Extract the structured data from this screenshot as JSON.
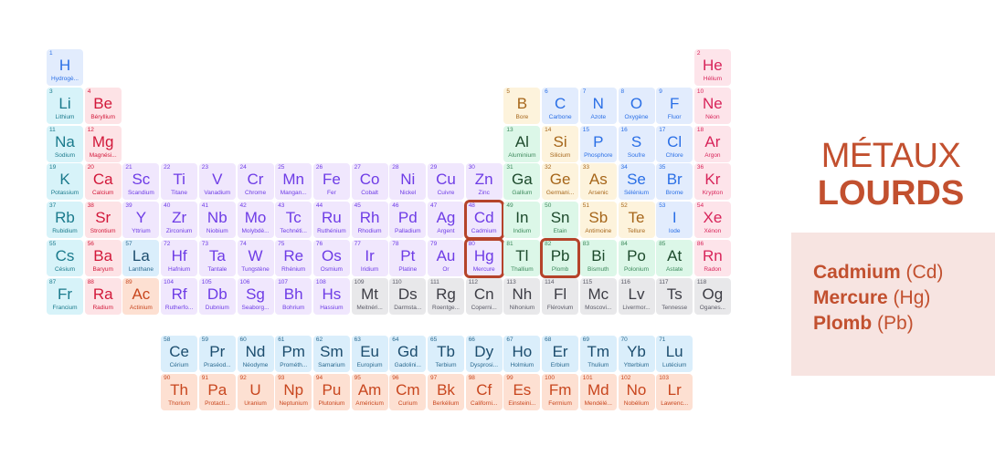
{
  "title": {
    "line1": "MÉTAUX",
    "line2": "LOURDS"
  },
  "heavy_metals": [
    {
      "name": "Cadmium",
      "symbol": "(Cd)"
    },
    {
      "name": "Mercure",
      "symbol": "(Hg)"
    },
    {
      "name": "Plomb",
      "symbol": "(Pb)"
    }
  ],
  "highlighted_symbols": [
    "Cd",
    "Hg",
    "Pb"
  ],
  "colors": {
    "accent": "#c2502f",
    "highlight_border": "#b5432a",
    "panel_bg": "#f7e4e1"
  },
  "elements": [
    {
      "n": 1,
      "s": "H",
      "name": "Hydrogè...",
      "c": "nonmetal",
      "row": 1,
      "col": 1
    },
    {
      "n": 2,
      "s": "He",
      "name": "Hélium",
      "c": "noble",
      "row": 1,
      "col": 18
    },
    {
      "n": 3,
      "s": "Li",
      "name": "Lithium",
      "c": "alkali",
      "row": 2,
      "col": 1
    },
    {
      "n": 4,
      "s": "Be",
      "name": "Béryllium",
      "c": "alkaline",
      "row": 2,
      "col": 2
    },
    {
      "n": 5,
      "s": "B",
      "name": "Bore",
      "c": "metalloid",
      "row": 2,
      "col": 13
    },
    {
      "n": 6,
      "s": "C",
      "name": "Carbone",
      "c": "nonmetal",
      "row": 2,
      "col": 14
    },
    {
      "n": 7,
      "s": "N",
      "name": "Azote",
      "c": "nonmetal",
      "row": 2,
      "col": 15
    },
    {
      "n": 8,
      "s": "O",
      "name": "Oxygène",
      "c": "nonmetal",
      "row": 2,
      "col": 16
    },
    {
      "n": 9,
      "s": "F",
      "name": "Fluor",
      "c": "nonmetal",
      "row": 2,
      "col": 17
    },
    {
      "n": 10,
      "s": "Ne",
      "name": "Néon",
      "c": "noble",
      "row": 2,
      "col": 18
    },
    {
      "n": 11,
      "s": "Na",
      "name": "Sodium",
      "c": "alkali",
      "row": 3,
      "col": 1
    },
    {
      "n": 12,
      "s": "Mg",
      "name": "Magnési...",
      "c": "alkaline",
      "row": 3,
      "col": 2
    },
    {
      "n": 13,
      "s": "Al",
      "name": "Aluminium",
      "c": "postt",
      "row": 3,
      "col": 13
    },
    {
      "n": 14,
      "s": "Si",
      "name": "Silicium",
      "c": "metalloid",
      "row": 3,
      "col": 14
    },
    {
      "n": 15,
      "s": "P",
      "name": "Phosphore",
      "c": "nonmetal",
      "row": 3,
      "col": 15
    },
    {
      "n": 16,
      "s": "S",
      "name": "Soufre",
      "c": "nonmetal",
      "row": 3,
      "col": 16
    },
    {
      "n": 17,
      "s": "Cl",
      "name": "Chlore",
      "c": "nonmetal",
      "row": 3,
      "col": 17
    },
    {
      "n": 18,
      "s": "Ar",
      "name": "Argon",
      "c": "noble",
      "row": 3,
      "col": 18
    },
    {
      "n": 19,
      "s": "K",
      "name": "Potassium",
      "c": "alkali",
      "row": 4,
      "col": 1
    },
    {
      "n": 20,
      "s": "Ca",
      "name": "Calcium",
      "c": "alkaline",
      "row": 4,
      "col": 2
    },
    {
      "n": 21,
      "s": "Sc",
      "name": "Scandium",
      "c": "transition",
      "row": 4,
      "col": 3
    },
    {
      "n": 22,
      "s": "Ti",
      "name": "Titane",
      "c": "transition",
      "row": 4,
      "col": 4
    },
    {
      "n": 23,
      "s": "V",
      "name": "Vanadium",
      "c": "transition",
      "row": 4,
      "col": 5
    },
    {
      "n": 24,
      "s": "Cr",
      "name": "Chrome",
      "c": "transition",
      "row": 4,
      "col": 6
    },
    {
      "n": 25,
      "s": "Mn",
      "name": "Mangan...",
      "c": "transition",
      "row": 4,
      "col": 7
    },
    {
      "n": 26,
      "s": "Fe",
      "name": "Fer",
      "c": "transition",
      "row": 4,
      "col": 8
    },
    {
      "n": 27,
      "s": "Co",
      "name": "Cobalt",
      "c": "transition",
      "row": 4,
      "col": 9
    },
    {
      "n": 28,
      "s": "Ni",
      "name": "Nickel",
      "c": "transition",
      "row": 4,
      "col": 10
    },
    {
      "n": 29,
      "s": "Cu",
      "name": "Cuivre",
      "c": "transition",
      "row": 4,
      "col": 11
    },
    {
      "n": 30,
      "s": "Zn",
      "name": "Zinc",
      "c": "transition",
      "row": 4,
      "col": 12
    },
    {
      "n": 31,
      "s": "Ga",
      "name": "Gallium",
      "c": "postt",
      "row": 4,
      "col": 13
    },
    {
      "n": 32,
      "s": "Ge",
      "name": "Germani...",
      "c": "metalloid",
      "row": 4,
      "col": 14
    },
    {
      "n": 33,
      "s": "As",
      "name": "Arsenic",
      "c": "metalloid",
      "row": 4,
      "col": 15
    },
    {
      "n": 34,
      "s": "Se",
      "name": "Sélénium",
      "c": "nonmetal",
      "row": 4,
      "col": 16
    },
    {
      "n": 35,
      "s": "Br",
      "name": "Brome",
      "c": "nonmetal",
      "row": 4,
      "col": 17
    },
    {
      "n": 36,
      "s": "Kr",
      "name": "Krypton",
      "c": "noble",
      "row": 4,
      "col": 18
    },
    {
      "n": 37,
      "s": "Rb",
      "name": "Rubidium",
      "c": "alkali",
      "row": 5,
      "col": 1
    },
    {
      "n": 38,
      "s": "Sr",
      "name": "Strontium",
      "c": "alkaline",
      "row": 5,
      "col": 2
    },
    {
      "n": 39,
      "s": "Y",
      "name": "Yttrium",
      "c": "transition",
      "row": 5,
      "col": 3
    },
    {
      "n": 40,
      "s": "Zr",
      "name": "Zirconium",
      "c": "transition",
      "row": 5,
      "col": 4
    },
    {
      "n": 41,
      "s": "Nb",
      "name": "Niobium",
      "c": "transition",
      "row": 5,
      "col": 5
    },
    {
      "n": 42,
      "s": "Mo",
      "name": "Molybdè...",
      "c": "transition",
      "row": 5,
      "col": 6
    },
    {
      "n": 43,
      "s": "Tc",
      "name": "Technéti...",
      "c": "transition",
      "row": 5,
      "col": 7
    },
    {
      "n": 44,
      "s": "Ru",
      "name": "Ruthénium",
      "c": "transition",
      "row": 5,
      "col": 8
    },
    {
      "n": 45,
      "s": "Rh",
      "name": "Rhodium",
      "c": "transition",
      "row": 5,
      "col": 9
    },
    {
      "n": 46,
      "s": "Pd",
      "name": "Palladium",
      "c": "transition",
      "row": 5,
      "col": 10
    },
    {
      "n": 47,
      "s": "Ag",
      "name": "Argent",
      "c": "transition",
      "row": 5,
      "col": 11
    },
    {
      "n": 48,
      "s": "Cd",
      "name": "Cadmium",
      "c": "transition",
      "row": 5,
      "col": 12
    },
    {
      "n": 49,
      "s": "In",
      "name": "Indium",
      "c": "postt",
      "row": 5,
      "col": 13
    },
    {
      "n": 50,
      "s": "Sn",
      "name": "Etain",
      "c": "postt",
      "row": 5,
      "col": 14
    },
    {
      "n": 51,
      "s": "Sb",
      "name": "Antimoine",
      "c": "metalloid",
      "row": 5,
      "col": 15
    },
    {
      "n": 52,
      "s": "Te",
      "name": "Tellure",
      "c": "metalloid",
      "row": 5,
      "col": 16
    },
    {
      "n": 53,
      "s": "I",
      "name": "Iode",
      "c": "nonmetal",
      "row": 5,
      "col": 17
    },
    {
      "n": 54,
      "s": "Xe",
      "name": "Xénon",
      "c": "noble",
      "row": 5,
      "col": 18
    },
    {
      "n": 55,
      "s": "Cs",
      "name": "Césium",
      "c": "alkali",
      "row": 6,
      "col": 1
    },
    {
      "n": 56,
      "s": "Ba",
      "name": "Baryum",
      "c": "alkaline",
      "row": 6,
      "col": 2
    },
    {
      "n": 57,
      "s": "La",
      "name": "Lanthane",
      "c": "lanth",
      "row": 6,
      "col": 3
    },
    {
      "n": 72,
      "s": "Hf",
      "name": "Hafnium",
      "c": "transition",
      "row": 6,
      "col": 4
    },
    {
      "n": 73,
      "s": "Ta",
      "name": "Tantale",
      "c": "transition",
      "row": 6,
      "col": 5
    },
    {
      "n": 74,
      "s": "W",
      "name": "Tungstène",
      "c": "transition",
      "row": 6,
      "col": 6
    },
    {
      "n": 75,
      "s": "Re",
      "name": "Rhénium",
      "c": "transition",
      "row": 6,
      "col": 7
    },
    {
      "n": 76,
      "s": "Os",
      "name": "Osmium",
      "c": "transition",
      "row": 6,
      "col": 8
    },
    {
      "n": 77,
      "s": "Ir",
      "name": "Iridium",
      "c": "transition",
      "row": 6,
      "col": 9
    },
    {
      "n": 78,
      "s": "Pt",
      "name": "Platine",
      "c": "transition",
      "row": 6,
      "col": 10
    },
    {
      "n": 79,
      "s": "Au",
      "name": "Or",
      "c": "transition",
      "row": 6,
      "col": 11
    },
    {
      "n": 80,
      "s": "Hg",
      "name": "Mercure",
      "c": "transition",
      "row": 6,
      "col": 12
    },
    {
      "n": 81,
      "s": "Tl",
      "name": "Thallium",
      "c": "postt",
      "row": 6,
      "col": 13
    },
    {
      "n": 82,
      "s": "Pb",
      "name": "Plomb",
      "c": "postt",
      "row": 6,
      "col": 14
    },
    {
      "n": 83,
      "s": "Bi",
      "name": "Bismuth",
      "c": "postt",
      "row": 6,
      "col": 15
    },
    {
      "n": 84,
      "s": "Po",
      "name": "Polonium",
      "c": "postt",
      "row": 6,
      "col": 16
    },
    {
      "n": 85,
      "s": "At",
      "name": "Astate",
      "c": "postt",
      "row": 6,
      "col": 17
    },
    {
      "n": 86,
      "s": "Rn",
      "name": "Radon",
      "c": "noble",
      "row": 6,
      "col": 18
    },
    {
      "n": 87,
      "s": "Fr",
      "name": "Francium",
      "c": "alkali",
      "row": 7,
      "col": 1
    },
    {
      "n": 88,
      "s": "Ra",
      "name": "Radium",
      "c": "alkaline",
      "row": 7,
      "col": 2
    },
    {
      "n": 89,
      "s": "Ac",
      "name": "Actinium",
      "c": "actin",
      "row": 7,
      "col": 3
    },
    {
      "n": 104,
      "s": "Rf",
      "name": "Rutherfo...",
      "c": "transition",
      "row": 7,
      "col": 4
    },
    {
      "n": 105,
      "s": "Db",
      "name": "Dubnium",
      "c": "transition",
      "row": 7,
      "col": 5
    },
    {
      "n": 106,
      "s": "Sg",
      "name": "Seaborg...",
      "c": "transition",
      "row": 7,
      "col": 6
    },
    {
      "n": 107,
      "s": "Bh",
      "name": "Bohrium",
      "c": "transition",
      "row": 7,
      "col": 7
    },
    {
      "n": 108,
      "s": "Hs",
      "name": "Hassium",
      "c": "transition",
      "row": 7,
      "col": 8
    },
    {
      "n": 109,
      "s": "Mt",
      "name": "Meitnéri...",
      "c": "unknown",
      "row": 7,
      "col": 9
    },
    {
      "n": 110,
      "s": "Ds",
      "name": "Darmsta...",
      "c": "unknown",
      "row": 7,
      "col": 10
    },
    {
      "n": 111,
      "s": "Rg",
      "name": "Roentge...",
      "c": "unknown",
      "row": 7,
      "col": 11
    },
    {
      "n": 112,
      "s": "Cn",
      "name": "Coperni...",
      "c": "unknown",
      "row": 7,
      "col": 12
    },
    {
      "n": 113,
      "s": "Nh",
      "name": "Nihonium",
      "c": "unknown",
      "row": 7,
      "col": 13
    },
    {
      "n": 114,
      "s": "Fl",
      "name": "Flérovium",
      "c": "unknown",
      "row": 7,
      "col": 14
    },
    {
      "n": 115,
      "s": "Mc",
      "name": "Moscovi...",
      "c": "unknown",
      "row": 7,
      "col": 15
    },
    {
      "n": 116,
      "s": "Lv",
      "name": "Livermor...",
      "c": "unknown",
      "row": 7,
      "col": 16
    },
    {
      "n": 117,
      "s": "Ts",
      "name": "Tennesse",
      "c": "unknown",
      "row": 7,
      "col": 17
    },
    {
      "n": 118,
      "s": "Og",
      "name": "Oganes...",
      "c": "unknown",
      "row": 7,
      "col": 18
    },
    {
      "n": 58,
      "s": "Ce",
      "name": "Cérium",
      "c": "lanth",
      "row": 9,
      "col": 4
    },
    {
      "n": 59,
      "s": "Pr",
      "name": "Praséod...",
      "c": "lanth",
      "row": 9,
      "col": 5
    },
    {
      "n": 60,
      "s": "Nd",
      "name": "Néodyme",
      "c": "lanth",
      "row": 9,
      "col": 6
    },
    {
      "n": 61,
      "s": "Pm",
      "name": "Prométh...",
      "c": "lanth",
      "row": 9,
      "col": 7
    },
    {
      "n": 62,
      "s": "Sm",
      "name": "Samarium",
      "c": "lanth",
      "row": 9,
      "col": 8
    },
    {
      "n": 63,
      "s": "Eu",
      "name": "Europium",
      "c": "lanth",
      "row": 9,
      "col": 9
    },
    {
      "n": 64,
      "s": "Gd",
      "name": "Gadolini...",
      "c": "lanth",
      "row": 9,
      "col": 10
    },
    {
      "n": 65,
      "s": "Tb",
      "name": "Terbium",
      "c": "lanth",
      "row": 9,
      "col": 11
    },
    {
      "n": 66,
      "s": "Dy",
      "name": "Dysprosi...",
      "c": "lanth",
      "row": 9,
      "col": 12
    },
    {
      "n": 67,
      "s": "Ho",
      "name": "Holmium",
      "c": "lanth",
      "row": 9,
      "col": 13
    },
    {
      "n": 68,
      "s": "Er",
      "name": "Erbium",
      "c": "lanth",
      "row": 9,
      "col": 14
    },
    {
      "n": 69,
      "s": "Tm",
      "name": "Thulium",
      "c": "lanth",
      "row": 9,
      "col": 15
    },
    {
      "n": 70,
      "s": "Yb",
      "name": "Ytterbium",
      "c": "lanth",
      "row": 9,
      "col": 16
    },
    {
      "n": 71,
      "s": "Lu",
      "name": "Lutécium",
      "c": "lanth",
      "row": 9,
      "col": 17
    },
    {
      "n": 90,
      "s": "Th",
      "name": "Thorium",
      "c": "actin",
      "row": 10,
      "col": 4
    },
    {
      "n": 91,
      "s": "Pa",
      "name": "Protacti...",
      "c": "actin",
      "row": 10,
      "col": 5
    },
    {
      "n": 92,
      "s": "U",
      "name": "Uranium",
      "c": "actin",
      "row": 10,
      "col": 6
    },
    {
      "n": 93,
      "s": "Np",
      "name": "Neptunium",
      "c": "actin",
      "row": 10,
      "col": 7
    },
    {
      "n": 94,
      "s": "Pu",
      "name": "Plutonium",
      "c": "actin",
      "row": 10,
      "col": 8
    },
    {
      "n": 95,
      "s": "Am",
      "name": "Américium",
      "c": "actin",
      "row": 10,
      "col": 9
    },
    {
      "n": 96,
      "s": "Cm",
      "name": "Curium",
      "c": "actin",
      "row": 10,
      "col": 10
    },
    {
      "n": 97,
      "s": "Bk",
      "name": "Berkélium",
      "c": "actin",
      "row": 10,
      "col": 11
    },
    {
      "n": 98,
      "s": "Cf",
      "name": "Californi...",
      "c": "actin",
      "row": 10,
      "col": 12
    },
    {
      "n": 99,
      "s": "Es",
      "name": "Einsteini...",
      "c": "actin",
      "row": 10,
      "col": 13
    },
    {
      "n": 100,
      "s": "Fm",
      "name": "Fermium",
      "c": "actin",
      "row": 10,
      "col": 14
    },
    {
      "n": 101,
      "s": "Md",
      "name": "Mendélé...",
      "c": "actin",
      "row": 10,
      "col": 15
    },
    {
      "n": 102,
      "s": "No",
      "name": "Nobélium",
      "c": "actin",
      "row": 10,
      "col": 16
    },
    {
      "n": 103,
      "s": "Lr",
      "name": "Lawrenc...",
      "c": "actin",
      "row": 10,
      "col": 17
    }
  ]
}
